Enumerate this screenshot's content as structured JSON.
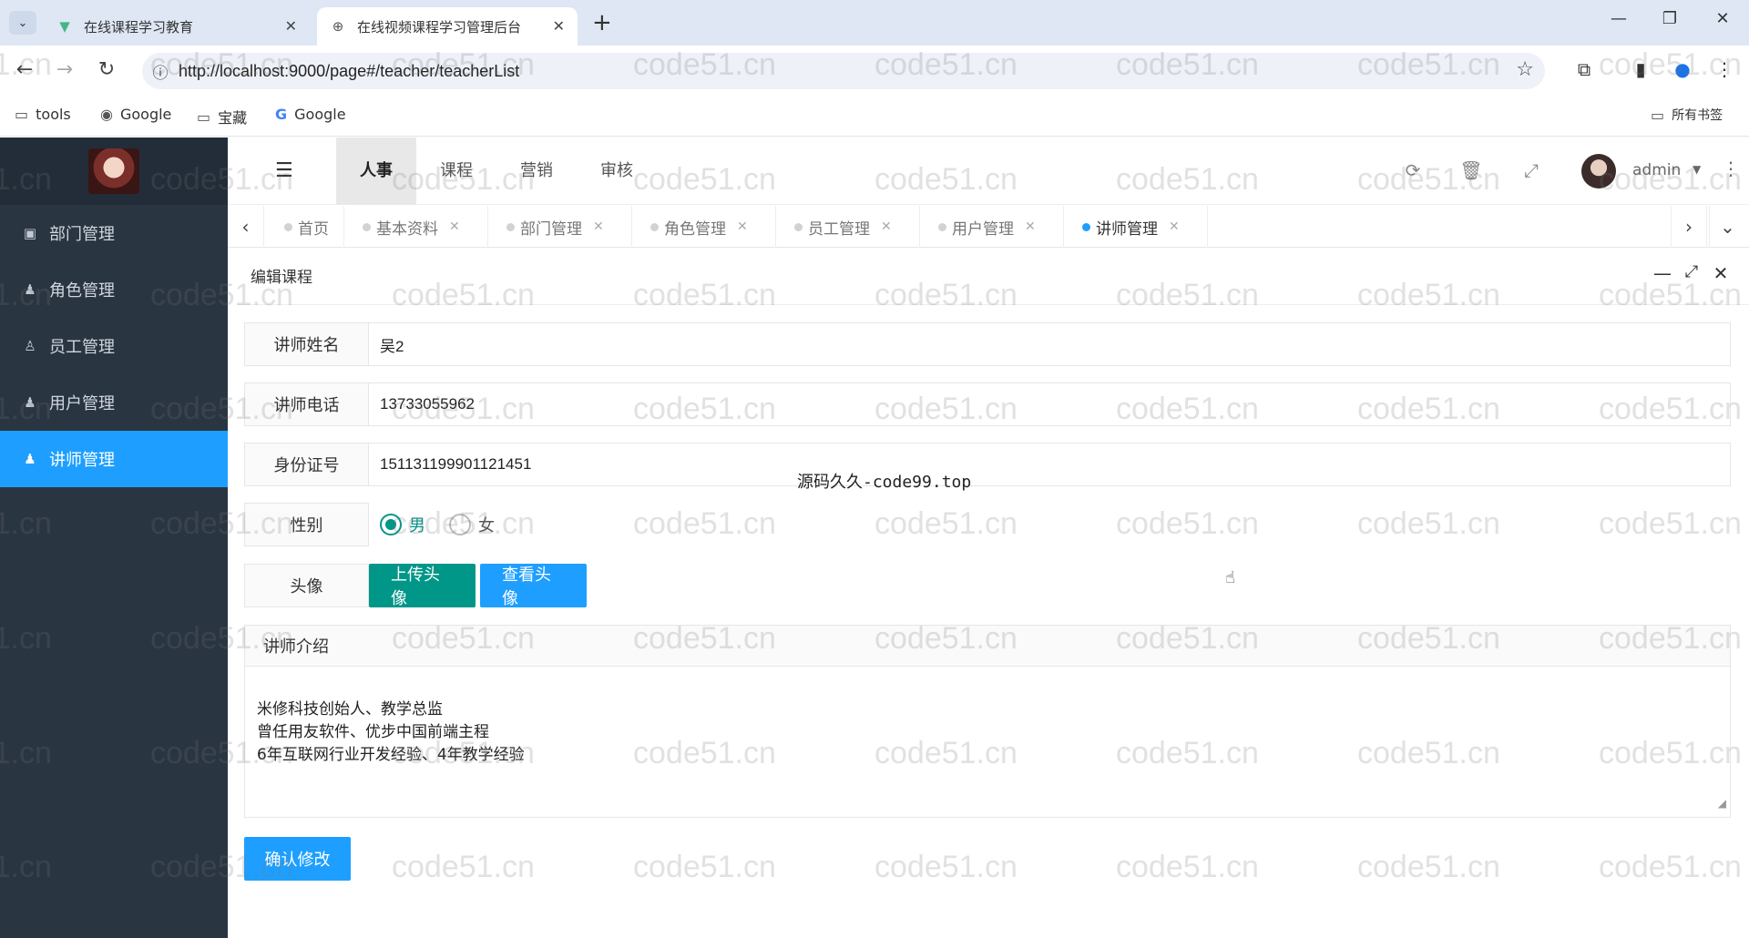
{
  "browser": {
    "tabs": [
      {
        "title": "在线课程学习教育",
        "active": false
      },
      {
        "title": "在线视频课程学习管理后台",
        "active": true
      }
    ],
    "url": "http://localhost:9000/page#/teacher/teacherList",
    "bookmarks": [
      "tools",
      "Google",
      "宝藏",
      "Google"
    ],
    "all_bookmarks_label": "所有书签"
  },
  "sidebar": {
    "items": [
      {
        "label": "部门管理",
        "icon": "id-card-icon",
        "active": false
      },
      {
        "label": "角色管理",
        "icon": "user-tie-icon",
        "active": false
      },
      {
        "label": "员工管理",
        "icon": "user-plus-icon",
        "active": false
      },
      {
        "label": "用户管理",
        "icon": "user-icon",
        "active": false
      },
      {
        "label": "讲师管理",
        "icon": "user-icon",
        "active": true
      }
    ]
  },
  "topnav": {
    "menus": [
      "人事",
      "课程",
      "营销",
      "审核"
    ],
    "active_menu": "人事",
    "username": "admin"
  },
  "page_tabs": [
    {
      "label": "首页",
      "closable": false,
      "active": false
    },
    {
      "label": "基本资料",
      "closable": true,
      "active": false
    },
    {
      "label": "部门管理",
      "closable": true,
      "active": false
    },
    {
      "label": "角色管理",
      "closable": true,
      "active": false
    },
    {
      "label": "员工管理",
      "closable": true,
      "active": false
    },
    {
      "label": "用户管理",
      "closable": true,
      "active": false
    },
    {
      "label": "讲师管理",
      "closable": true,
      "active": true
    }
  ],
  "dialog": {
    "title": "编辑课程",
    "fields": {
      "name": {
        "label": "讲师姓名",
        "value": "吴2"
      },
      "phone": {
        "label": "讲师电话",
        "value": "13733055962"
      },
      "id_card": {
        "label": "身份证号",
        "value": "151131199901121451"
      },
      "gender": {
        "label": "性别",
        "options": [
          "男",
          "女"
        ],
        "selected": "男"
      },
      "avatar": {
        "label": "头像",
        "upload_button": "上传头像",
        "view_button": "查看头像"
      }
    },
    "intro": {
      "label": "讲师介绍",
      "value": "米修科技创始人、教学总监\n曾任用友软件、优步中国前端主程\n6年互联网行业开发经验、4年教学经验"
    },
    "submit_label": "确认修改"
  },
  "overlay_text": "源码久久-code99.top",
  "watermark": "code51.cn",
  "colors": {
    "sidebar_bg": "#2a3542",
    "primary_blue": "#1e9fff",
    "primary_green": "#009688"
  }
}
